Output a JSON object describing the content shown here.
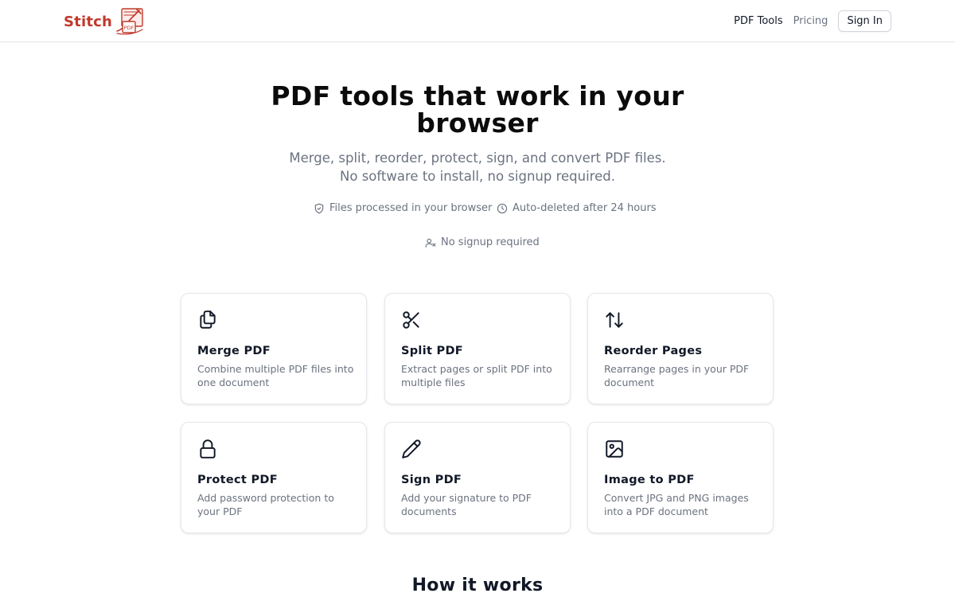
{
  "brand": {
    "name": "Stitch",
    "mark_text": "PDF",
    "logo_icon": "pdf-stitch-logo-icon",
    "color": "#c0392b"
  },
  "nav": {
    "items": [
      {
        "label": "PDF Tools"
      },
      {
        "label": "Pricing"
      }
    ],
    "sign_in_label": "Sign In"
  },
  "hero": {
    "title": "PDF tools that work in your browser",
    "subtitle_line1": "Merge, split, reorder, protect, sign, and convert PDF files.",
    "subtitle_line2": "No software to install, no signup required."
  },
  "features": [
    {
      "icon": "shield-check-icon",
      "label": "Files processed in your browser"
    },
    {
      "icon": "clock-icon",
      "label": "Auto-deleted after 24 hours"
    },
    {
      "icon": "user-x-icon",
      "label": "No signup required"
    }
  ],
  "tools": [
    {
      "icon": "files-icon",
      "title": "Merge PDF",
      "description": "Combine multiple PDF files into one document"
    },
    {
      "icon": "scissors-icon",
      "title": "Split PDF",
      "description": "Extract pages or split PDF into multiple files"
    },
    {
      "icon": "arrows-up-down-icon",
      "title": "Reorder Pages",
      "description": "Rearrange pages in your PDF document"
    },
    {
      "icon": "lock-icon",
      "title": "Protect PDF",
      "description": "Add password protection to your PDF"
    },
    {
      "icon": "pen-icon",
      "title": "Sign PDF",
      "description": "Add your signature to PDF documents"
    },
    {
      "icon": "image-icon",
      "title": "Image to PDF",
      "description": "Convert JPG and PNG images into a PDF document"
    }
  ],
  "how_it_works": {
    "title": "How it works"
  },
  "colors": {
    "text": "#111827",
    "muted": "#6b7280",
    "border": "#e5e7eb"
  }
}
